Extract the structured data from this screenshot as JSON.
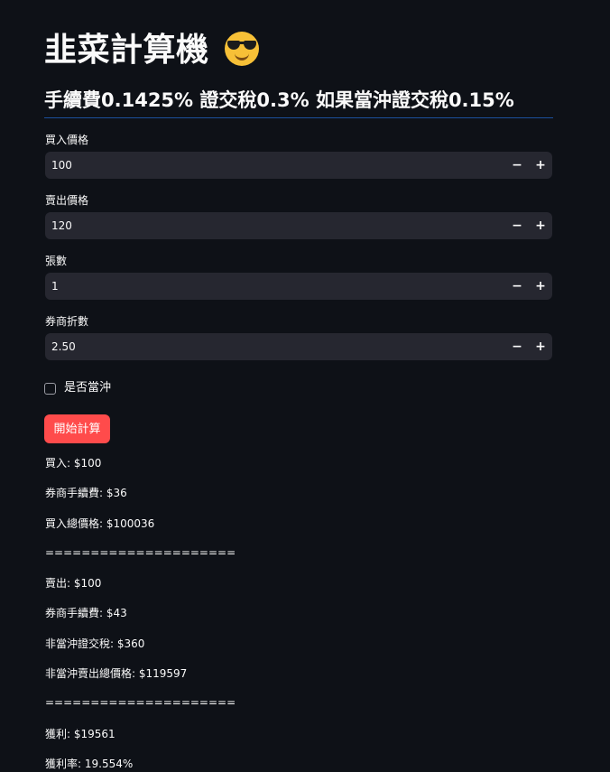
{
  "header": {
    "title": "韭菜計算機",
    "title_emoji_icon": "smiling-face-with-sunglasses-icon",
    "subtitle": "手續費0.1425% 證交稅0.3% 如果當沖證交稅0.15%"
  },
  "colors": {
    "background": "#0e1117",
    "input_background": "#262730",
    "primary_button": "#ff4b4b",
    "divider": "#1c4f9c",
    "text": "#fafafa"
  },
  "inputs": {
    "buy_price": {
      "label": "買入價格",
      "value": "100"
    },
    "sell_price": {
      "label": "賣出價格",
      "value": "120"
    },
    "lots": {
      "label": "張數",
      "value": "1"
    },
    "discount": {
      "label": "券商折數",
      "value": "2.50"
    },
    "stepper": {
      "minus": "−",
      "plus": "+"
    }
  },
  "day_trade_checkbox": {
    "label": "是否當沖",
    "checked": false
  },
  "calculate_button": {
    "label": "開始計算"
  },
  "results": [
    "買入: $100",
    "券商手續費: $36",
    "買入總價格: $100036",
    "=====================",
    "賣出: $100",
    "券商手續費: $43",
    "非當沖證交稅: $360",
    "非當沖賣出總價格: $119597",
    "=====================",
    "獲利: $19561",
    "獲利率: 19.554%"
  ]
}
